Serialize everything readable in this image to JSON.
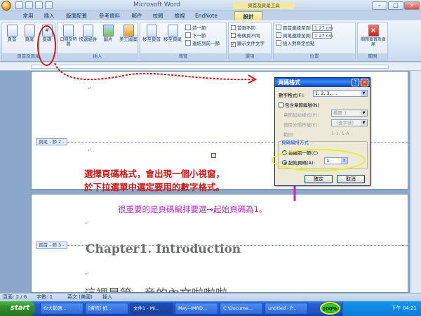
{
  "window": {
    "app_title": "Microsoft Word",
    "context_title": "頁首及頁尾工具",
    "controls": [
      "–",
      "□",
      "×"
    ]
  },
  "tabs": [
    "常用",
    "插入",
    "版面配置",
    "參考資料",
    "郵件",
    "校閱",
    "檢視",
    "EndNote",
    "設計"
  ],
  "active_tab": "設計",
  "ribbon": {
    "groups": {
      "header_footer": {
        "label": "頁首及頁尾",
        "buttons": [
          "頁首",
          "頁尾",
          "頁碼"
        ]
      },
      "insert": {
        "label": "插入",
        "buttons": [
          "日期及時間",
          "快速組件",
          "圖片",
          "美工圖案"
        ]
      },
      "navigation": {
        "label": "導覽",
        "big_buttons": [
          "移至頁首",
          "移至頁尾"
        ],
        "small_buttons": [
          "前一節",
          "下一節",
          "連結到前一節"
        ]
      },
      "options": {
        "label": "選項",
        "checkboxes": [
          {
            "label": "首頁不同",
            "checked": false
          },
          {
            "label": "奇偶頁不同",
            "checked": false
          },
          {
            "label": "顯示文件文字",
            "checked": true
          }
        ]
      },
      "position": {
        "label": "位置",
        "header_from_top_label": "頁首邊緣至頁面頂端的距離",
        "header_from_top_value": "1.27 cm",
        "footer_from_bottom_label": "頁尾邊緣至頁面底端的距離",
        "footer_from_bottom_value": "1.27 cm",
        "align_tab": "插入對齊定位點"
      },
      "close": {
        "label": "關閉",
        "button": "關閉頁首及頁尾"
      }
    }
  },
  "document": {
    "header_tag_1": "頁尾 - 節 2 -",
    "header_tag_2": "頁首 - 節 3 -",
    "chapter_heading": "Chapter1. Introduction",
    "body_line": "這裡是第一章的內文啦啦啦",
    "para_mark": "↵"
  },
  "annotations": {
    "red_line_1": "選擇頁碼格式，會出現一個小視窗，",
    "red_line_2": "於下拉選單中選定要用的數字格式。",
    "pink_note": "很重要的是頁碼編排要選→起始頁碼為1。"
  },
  "dialog": {
    "title": "頁碼格式",
    "help": "?",
    "close": "×",
    "number_format_label": "數字格式(F):",
    "number_format_value": "1, 2, 3, …",
    "include_chapter_label": "包含章節編號(N)",
    "chapter_style_label": "章節起始樣式(P):",
    "chapter_style_value": "標題 1",
    "separator_label": "使用分隔符號(E):",
    "separator_value": "- (連字號)",
    "examples_label": "範例:",
    "examples_value": "1-1, 1-A",
    "numbering_section": "頁碼編排方式",
    "continue_label": "接續前一節(C)",
    "start_at_label": "起始頁碼(A):",
    "start_at_value": "1",
    "ok": "確定",
    "cancel": "取消"
  },
  "status_bar": {
    "page": "頁面: 2 / 6",
    "words": "字數: 1",
    "language": "英文 (美國)",
    "mode": "插入"
  },
  "taskbar": {
    "start": "start",
    "items": [
      "6r大影題...",
      "[資訊] 如...",
      "文件1 - Mi...",
      "May--IMRD...",
      "C:\\Docume...",
      "untitled - P..."
    ],
    "zoom": "100%",
    "clock": "下午 04:21"
  }
}
